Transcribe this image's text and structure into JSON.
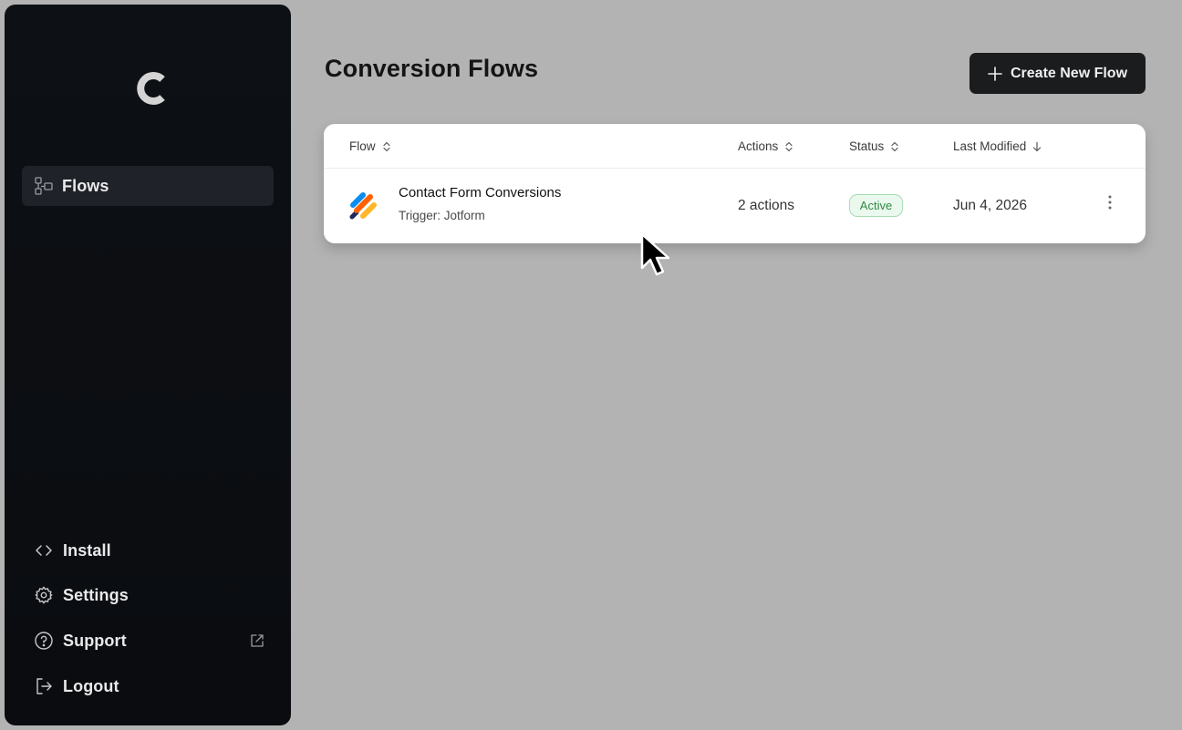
{
  "sidebar": {
    "logo_icon": "c-logo-icon",
    "nav": {
      "flows": {
        "label": "Flows",
        "icon": "flows-icon"
      }
    },
    "bottom": [
      {
        "label": "Install",
        "icon": "code-icon"
      },
      {
        "label": "Settings",
        "icon": "gear-icon"
      },
      {
        "label": "Support",
        "icon": "help-circle-icon",
        "trailing_icon": "external-link-icon"
      },
      {
        "label": "Logout",
        "icon": "logout-icon"
      }
    ]
  },
  "header": {
    "title": "Conversion Flows",
    "create_button": {
      "label": "Create New Flow",
      "icon": "plus-icon"
    }
  },
  "table": {
    "columns": [
      "Flow",
      "Actions",
      "Status",
      "Last Modified"
    ],
    "rows": [
      {
        "name": "Contact Form Conversions",
        "trigger": "Trigger: Jotform",
        "actions": "2 actions",
        "status": "Active",
        "last_modified": "Jun 4, 2026"
      }
    ]
  },
  "colors": {
    "sidebar_bg": "#0b0d11",
    "page_bg": "#b3b3b3",
    "primary_button": "#1b1c1e",
    "active_badge_text": "#2f8a45",
    "active_badge_bg": "#eaf8ee"
  }
}
